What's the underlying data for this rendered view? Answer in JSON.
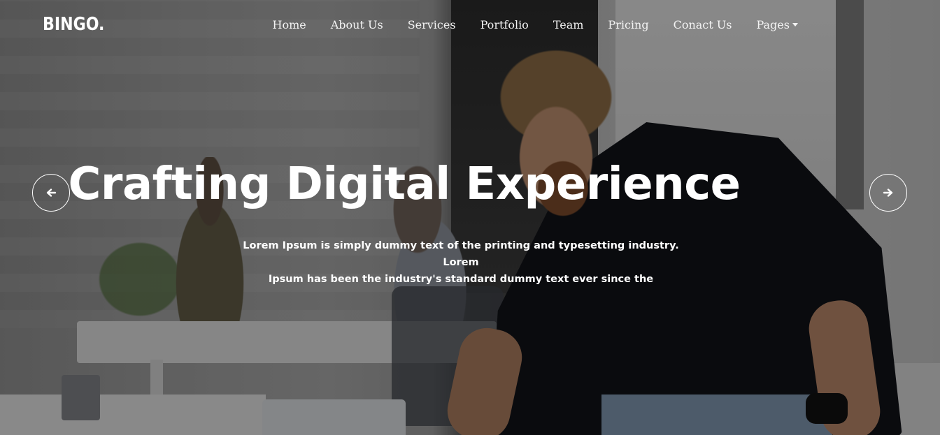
{
  "brand": {
    "logo_text": "BINGO."
  },
  "nav": {
    "items": [
      {
        "label": "Home"
      },
      {
        "label": "About Us"
      },
      {
        "label": "Services"
      },
      {
        "label": "Portfolio"
      },
      {
        "label": "Team"
      },
      {
        "label": "Pricing"
      },
      {
        "label": "Conact Us"
      },
      {
        "label": "Pages",
        "has_dropdown": true
      }
    ]
  },
  "hero": {
    "headline": "Crafting Digital Experience",
    "subtext_line1": "Lorem Ipsum is simply dummy text of the printing and typesetting industry. Lorem",
    "subtext_line2": "Ipsum has been the industry's standard dummy text ever since the",
    "prev_icon": "arrow-left-icon",
    "next_icon": "arrow-right-icon",
    "text_color": "#ffffff",
    "overlay_color": "rgba(0,0,0,0.38)"
  }
}
